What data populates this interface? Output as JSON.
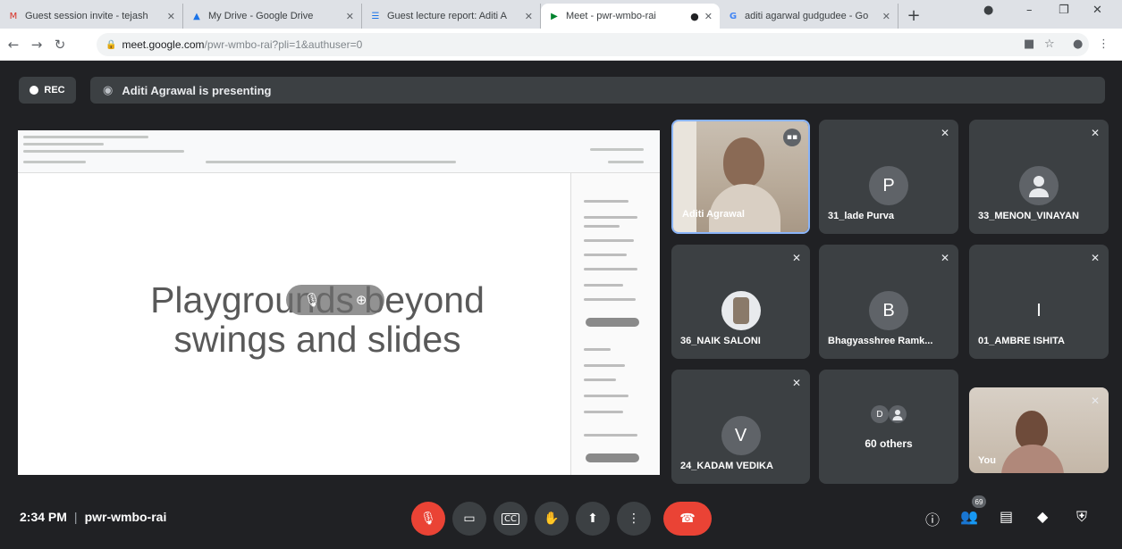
{
  "browser": {
    "tabs": [
      {
        "title": "Guest session invite - tejash",
        "icon": "gmail-icon",
        "glyph": "M"
      },
      {
        "title": "My Drive - Google Drive",
        "icon": "drive-icon",
        "glyph": "▲"
      },
      {
        "title": "Guest lecture report: Aditi A",
        "icon": "docs-icon",
        "glyph": "☰"
      },
      {
        "title": "Meet - pwr-wmbo-rai",
        "icon": "meet-icon",
        "glyph": "▶"
      },
      {
        "title": "aditi agarwal gudgudee - Go",
        "icon": "google-icon",
        "glyph": "G"
      }
    ],
    "url_host": "meet.google.com",
    "url_path": "/pwr-wmbo-rai?pli=1&authuser=0"
  },
  "meeting": {
    "rec_label": "REC",
    "presenting_text": "Aditi Agrawal is presenting",
    "code": "pwr-wmbo-rai",
    "time": "2:34 PM",
    "participant_count": "69"
  },
  "slide": {
    "title_line1": "Playgrounds beyond",
    "title_line2": "swings and slides"
  },
  "participants": [
    {
      "name": "Aditi Agrawal",
      "type": "video",
      "speaking": true
    },
    {
      "name": "31_lade Purva",
      "initial": "P",
      "color": "#5f6368",
      "muted": true
    },
    {
      "name": "33_MENON_VINAYAN",
      "type": "person-icon",
      "muted": true
    },
    {
      "name": "36_NAIK SALONI",
      "type": "photo",
      "muted": true
    },
    {
      "name": "Bhagyasshree Ramk...",
      "initial": "B",
      "color": "#5f6368",
      "muted": true
    },
    {
      "name": "01_AMBRE ISHITA",
      "initial": "I",
      "color": "#3c4043",
      "muted": true
    },
    {
      "name": "24_KADAM VEDIKA",
      "initial": "V",
      "color": "#5f6368",
      "muted": true
    },
    {
      "name": "60 others",
      "initial": "D",
      "color": "#5f6368"
    },
    {
      "name": "You",
      "type": "video",
      "muted": true
    }
  ]
}
